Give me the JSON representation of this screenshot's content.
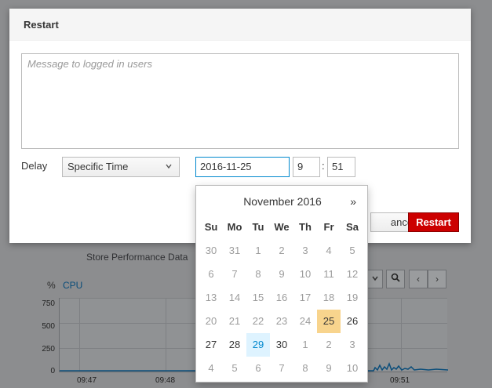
{
  "background": {
    "section_title": "Store Performance Data",
    "chart": {
      "unit": "%",
      "series_label": "CPU",
      "y_ticks": [
        "750",
        "500",
        "250",
        "0"
      ],
      "x_ticks": [
        "09:47",
        "09:48",
        "09:51"
      ]
    },
    "toolbar": {
      "zoom_icon": "zoom-icon",
      "prev_label": "‹",
      "next_label": "›"
    }
  },
  "modal": {
    "title": "Restart",
    "message_placeholder": "Message to logged in users",
    "delay_label": "Delay",
    "delay_value": "Specific Time",
    "date_value": "2016-11-25",
    "hour_value": "9",
    "time_separator": ":",
    "minute_value": "51",
    "cancel_label": "Cancel",
    "cancel_visible_text": "ancel",
    "restart_label": "Restart"
  },
  "datepicker": {
    "title": "November 2016",
    "next_label": "»",
    "weekdays": [
      "Su",
      "Mo",
      "Tu",
      "We",
      "Th",
      "Fr",
      "Sa"
    ],
    "weeks": [
      [
        "30",
        "31",
        "1",
        "2",
        "3",
        "4",
        "5"
      ],
      [
        "6",
        "7",
        "8",
        "9",
        "10",
        "11",
        "12"
      ],
      [
        "13",
        "14",
        "15",
        "16",
        "17",
        "18",
        "19"
      ],
      [
        "20",
        "21",
        "22",
        "23",
        "24",
        "25",
        "26"
      ],
      [
        "27",
        "28",
        "29",
        "30",
        "1",
        "2",
        "3"
      ],
      [
        "4",
        "5",
        "6",
        "7",
        "8",
        "9",
        "10"
      ]
    ],
    "selected": "25",
    "today": "29"
  },
  "colors": {
    "primary_button": "#cc0000",
    "selected_day": "#f8d48d",
    "today_day": "#def3ff",
    "focus": "#0088ce"
  }
}
